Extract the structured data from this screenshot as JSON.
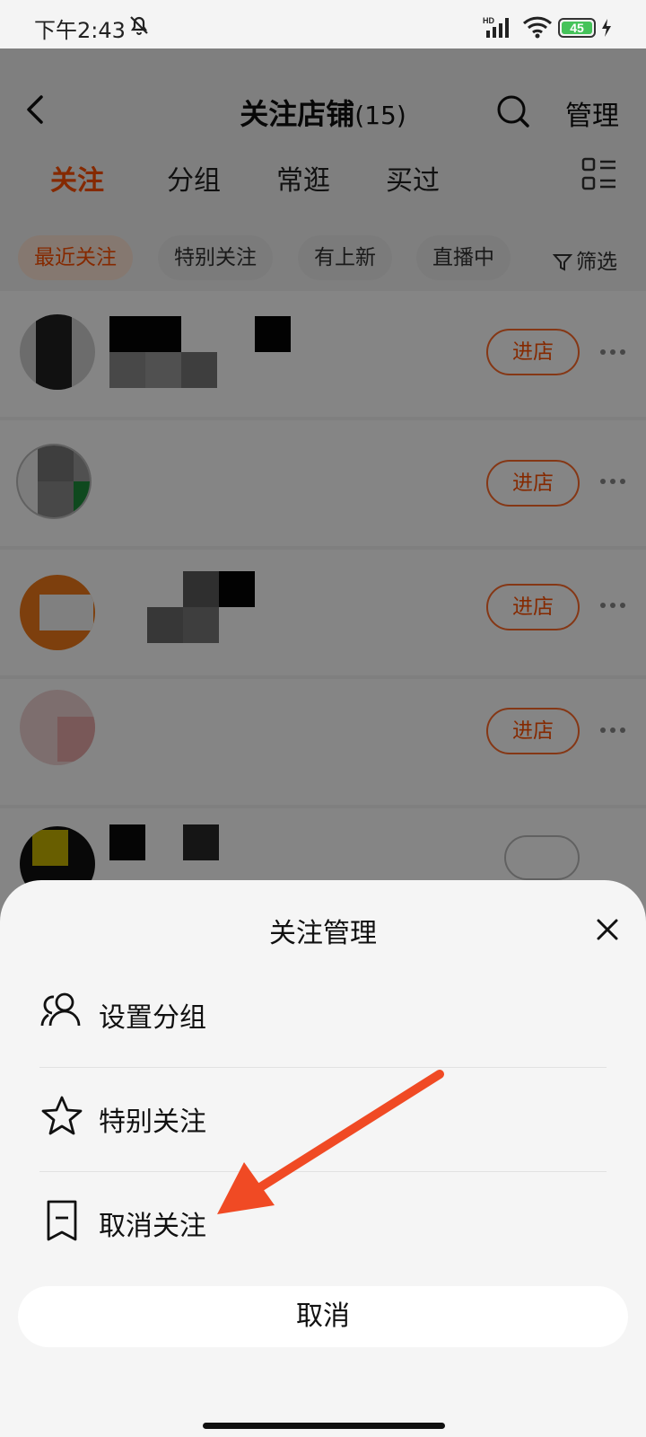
{
  "status_bar": {
    "time": "下午2:43",
    "battery_level": "45",
    "network": "HD",
    "bell_icon": "bell-off-icon"
  },
  "header": {
    "title": "关注店铺",
    "count": "(15)",
    "manage_label": "管理"
  },
  "tabs": [
    {
      "label": "关注",
      "active": true
    },
    {
      "label": "分组",
      "active": false
    },
    {
      "label": "常逛",
      "active": false
    },
    {
      "label": "买过",
      "active": false
    }
  ],
  "chips": [
    {
      "label": "最近关注",
      "active": true
    },
    {
      "label": "特别关注",
      "active": false
    },
    {
      "label": "有上新",
      "active": false
    },
    {
      "label": "直播中",
      "active": false
    }
  ],
  "filter_label": "筛选",
  "stores": [
    {
      "enter_label": "进店"
    },
    {
      "enter_label": "进店"
    },
    {
      "enter_label": "进店"
    },
    {
      "enter_label": "进店"
    }
  ],
  "sheet": {
    "title": "关注管理",
    "options": [
      {
        "label": "设置分组",
        "icon": "group-icon"
      },
      {
        "label": "特别关注",
        "icon": "star-icon"
      },
      {
        "label": "取消关注",
        "icon": "bookmark-minus-icon"
      }
    ],
    "cancel_label": "取消"
  },
  "colors": {
    "accent": "#ff5000",
    "arrow": "#f04a24"
  }
}
